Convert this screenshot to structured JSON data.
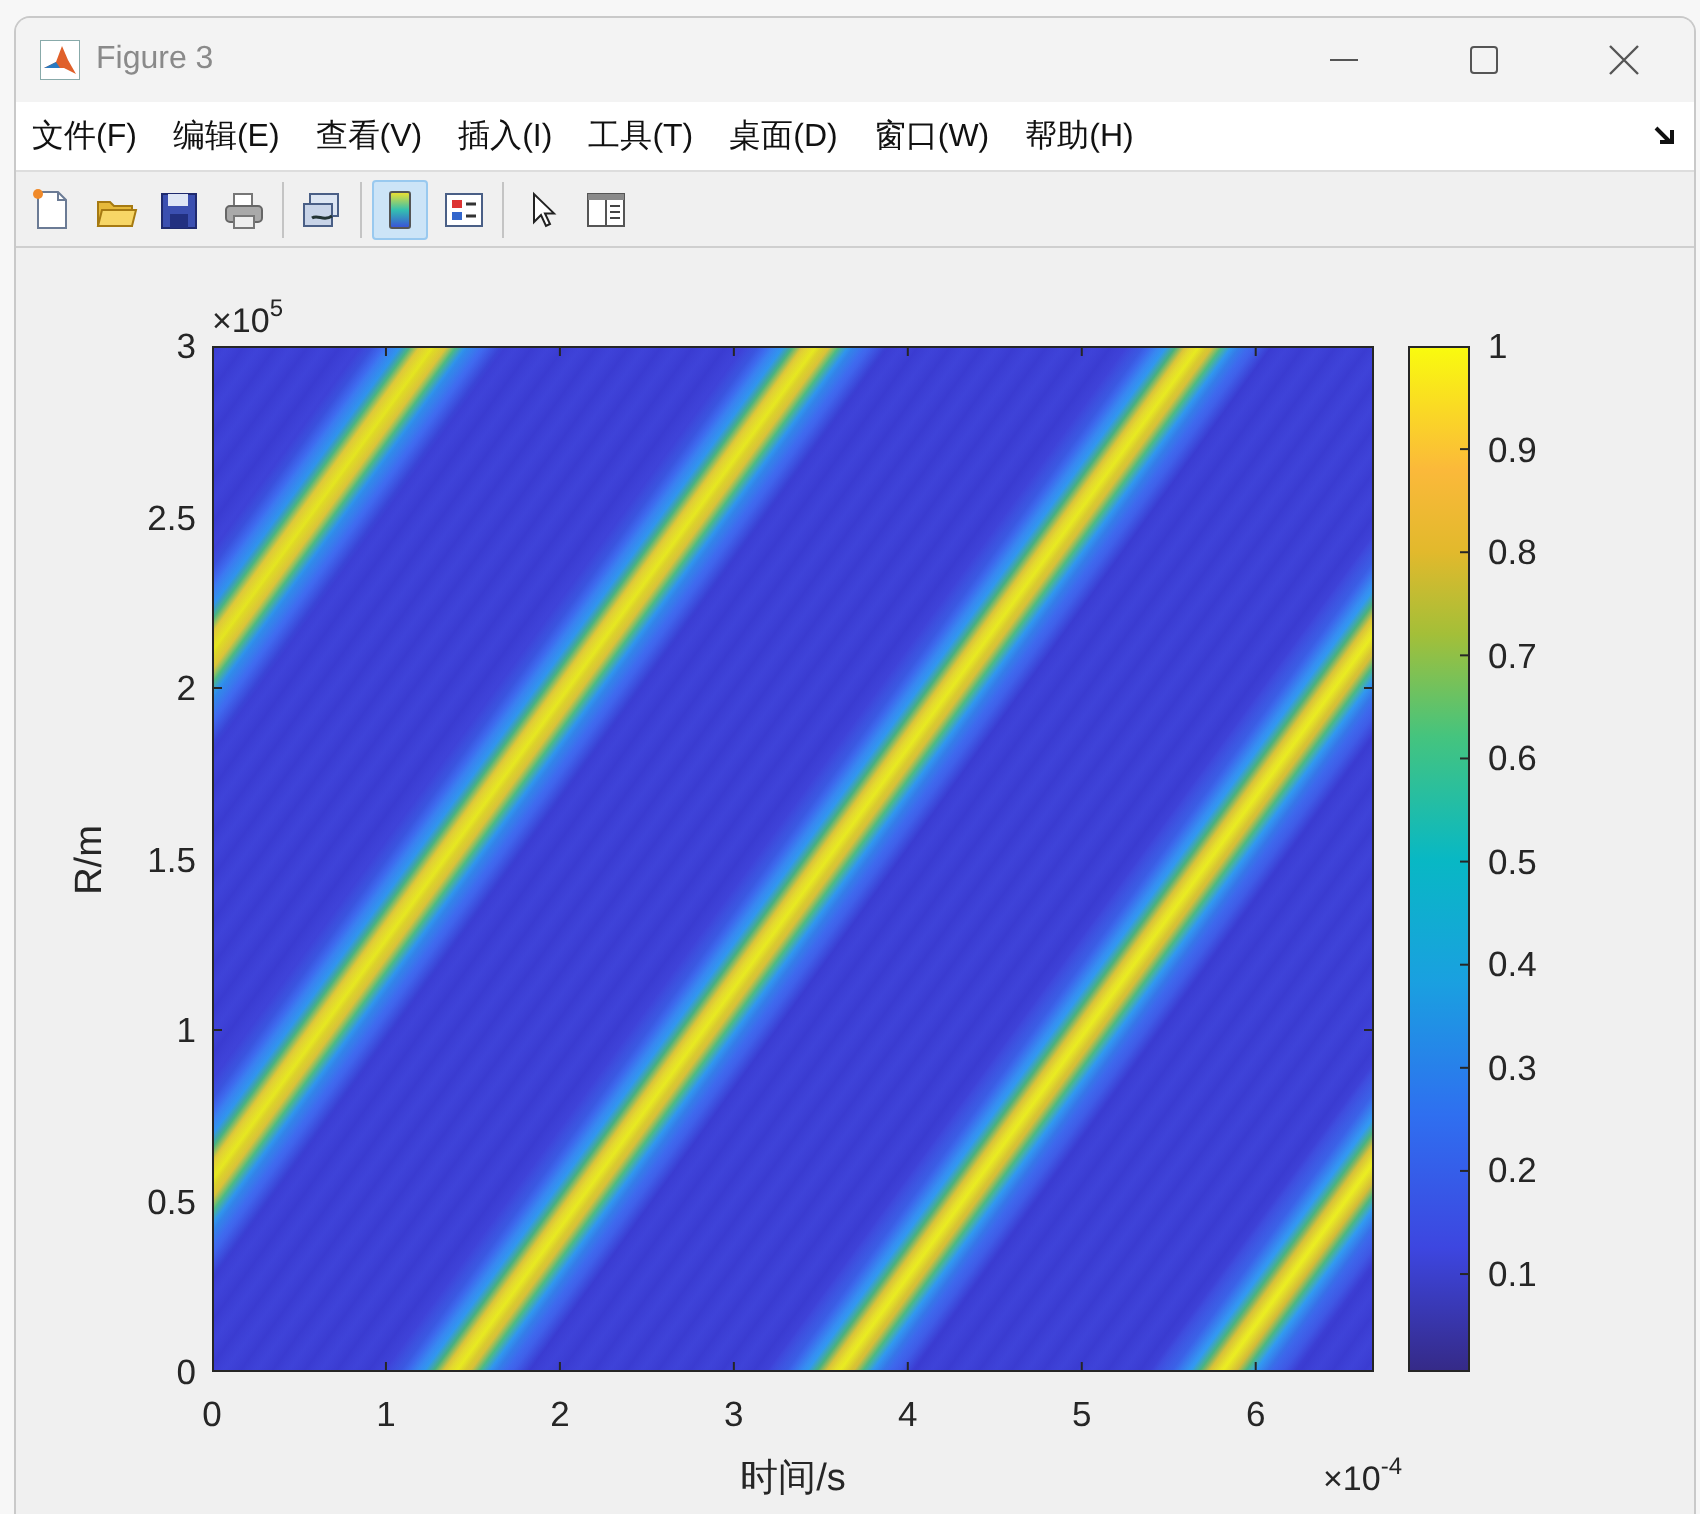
{
  "window": {
    "title": "Figure 3"
  },
  "menu": [
    "文件(F)",
    "编辑(E)",
    "查看(V)",
    "插入(I)",
    "工具(T)",
    "桌面(D)",
    "窗口(W)",
    "帮助(H)"
  ],
  "toolbar": {
    "groups": [
      [
        {
          "pressed": false
        },
        {
          "pressed": false
        },
        {
          "pressed": false
        },
        {
          "pressed": false
        }
      ],
      [
        {
          "pressed": false
        }
      ],
      [
        {
          "pressed": true
        },
        {
          "pressed": false
        }
      ],
      [
        {
          "pressed": false
        },
        {
          "pressed": false
        }
      ]
    ]
  },
  "plot": {
    "ylabel": "R/m",
    "xlabel": "时间/s",
    "y_exponent": "×10$^{5}$",
    "x_exponent": "×10$^{-4}$",
    "yticks": [
      "3",
      "2.5",
      "2",
      "1.5",
      "1",
      "0.5",
      "0"
    ],
    "xticks": [
      "0",
      "1",
      "2",
      "3",
      "4",
      "5",
      "6"
    ],
    "colorbar": {
      "ticks": [
        "1",
        "0.9",
        "0.8",
        "0.7",
        "0.6",
        "0.5",
        "0.4",
        "0.3",
        "0.2",
        "0.1"
      ]
    }
  }
}
